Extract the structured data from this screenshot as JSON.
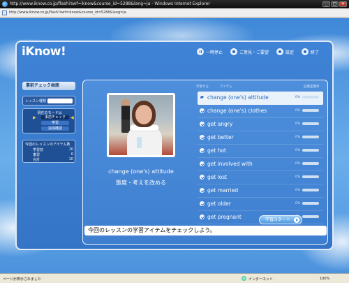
{
  "window": {
    "title": "http://www.iknow.co.jp/flash?swf=iknow&course_id=5288&lang=ja - Windows Internet Explorer",
    "url": "http://www.iknow.co.jp/flash?swf=iknow&course_id=5288&lang=ja"
  },
  "app": {
    "logo": "iKnow!",
    "nav": {
      "pause": "一時停止",
      "feedback": "ご意見・ご要望",
      "settings": "設定",
      "exit": "終了"
    }
  },
  "sidebar": {
    "review_tab": "事前チェック画面",
    "lesson_type_label": "レッスン種類",
    "lesson_type_value": "",
    "mode_title": "現在のモードは",
    "mode_options": [
      "事前チェック",
      "学習",
      "完成確認"
    ],
    "stats_title": "今回のレッスンのアイテム数",
    "stats": [
      {
        "label": "学習前",
        "value": "10"
      },
      {
        "label": "復習",
        "value": "0"
      },
      {
        "label": "合計",
        "value": "10"
      }
    ]
  },
  "card": {
    "column_headers": [
      "学習する",
      "アイテム",
      "記憶定着率"
    ],
    "current_item_en": "change (one's) attitude",
    "current_item_jp": "態度・考えを改める",
    "items": [
      {
        "text": "change (one's) attitude",
        "pct": "0%",
        "selected": true
      },
      {
        "text": "change (one's) clothes",
        "pct": "0%",
        "selected": false
      },
      {
        "text": "get angry",
        "pct": "0%",
        "selected": false
      },
      {
        "text": "get better",
        "pct": "0%",
        "selected": false
      },
      {
        "text": "get hot",
        "pct": "0%",
        "selected": false
      },
      {
        "text": "get involved with",
        "pct": "0%",
        "selected": false
      },
      {
        "text": "get lost",
        "pct": "0%",
        "selected": false
      },
      {
        "text": "get married",
        "pct": "0%",
        "selected": false
      },
      {
        "text": "get older",
        "pct": "0%",
        "selected": false
      },
      {
        "text": "get pregnant",
        "pct": "0%",
        "selected": false
      }
    ],
    "message": "今回のレッスンの学習アイテムをチェックしよう。"
  },
  "start_button": "学習スタート",
  "statusbar": {
    "text": "ページが表示されました",
    "zone": "インターネット",
    "zoom": "100%"
  }
}
